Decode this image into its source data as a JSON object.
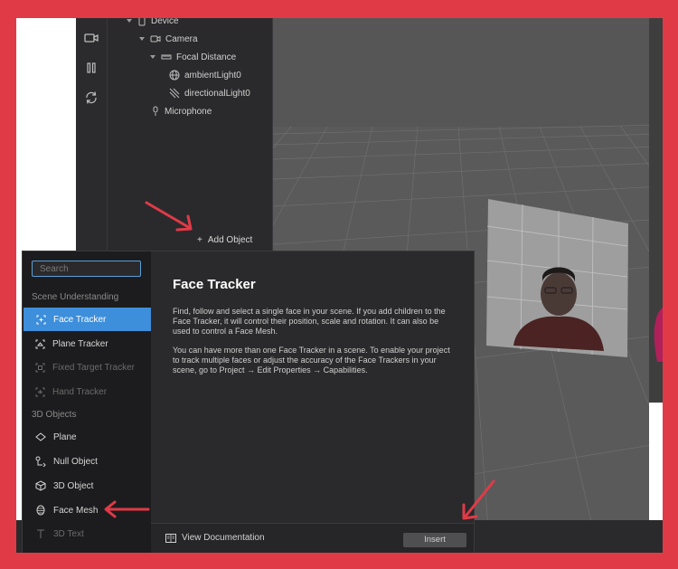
{
  "scene_tree": {
    "items": [
      {
        "label": "Device"
      },
      {
        "label": "Camera"
      },
      {
        "label": "Focal Distance"
      },
      {
        "label": "ambientLight0"
      },
      {
        "label": "directionalLight0"
      },
      {
        "label": "Microphone"
      }
    ],
    "add_object_label": "Add Object"
  },
  "dialog": {
    "search_placeholder": "Search",
    "sections": [
      {
        "label": "Scene Understanding"
      },
      {
        "label": "3D Objects"
      }
    ],
    "items": [
      {
        "label": "Face Tracker",
        "selected": true
      },
      {
        "label": "Plane Tracker"
      },
      {
        "label": "Fixed Target Tracker",
        "disabled": true
      },
      {
        "label": "Hand Tracker",
        "disabled": true
      },
      {
        "label": "Plane"
      },
      {
        "label": "Null Object"
      },
      {
        "label": "3D Object"
      },
      {
        "label": "Face Mesh"
      },
      {
        "label": "3D Text",
        "disabled": true
      }
    ],
    "detail": {
      "title": "Face Tracker",
      "paragraph_1": "Find, follow and select a single face in your scene. If you add children to the Face Tracker, it will control their position, scale and rotation. It can also be used to control a Face Mesh.",
      "paragraph_2": "You can have more than one Face Tracker in a scene. To enable your project to track multiple faces or adjust the accuracy of the Face Trackers in your scene, go to Project → Edit Properties → Capabilities."
    },
    "footer": {
      "view_documentation_label": "View Documentation",
      "insert_label": "Insert"
    }
  },
  "colors": {
    "frame": "#e13a47",
    "accent": "#3d8edb",
    "annotation_arrow": "#e13a47"
  }
}
